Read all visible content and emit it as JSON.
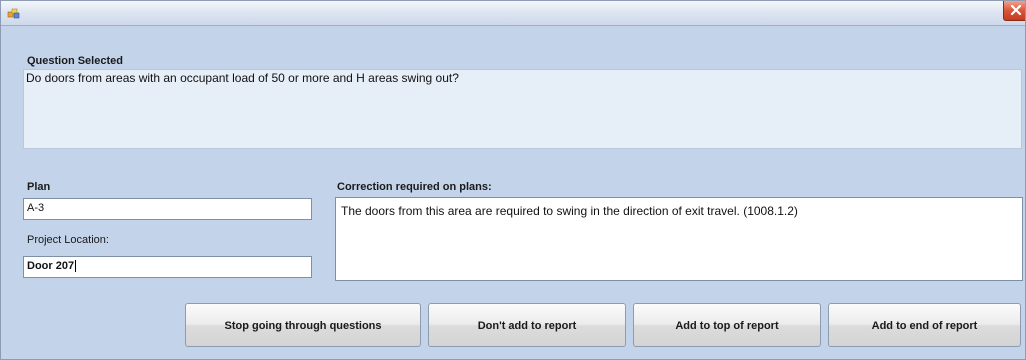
{
  "window": {
    "title": "",
    "accent_color": "#c3d3ea",
    "icons": {
      "app": "app-icon",
      "close": "close-icon"
    }
  },
  "question": {
    "label": "Question Selected",
    "text": "Do doors from areas with an occupant load of 50 or more and H areas swing out?"
  },
  "plan": {
    "label": "Plan",
    "value": "A-3"
  },
  "project_location": {
    "label": "Project Location:",
    "value": "Door 207"
  },
  "correction": {
    "label": "Correction required on plans:",
    "text": "The doors from this area are required to swing in the direction of exit travel. (1008.1.2)"
  },
  "buttons": {
    "stop": "Stop going through questions",
    "dont_add": "Don't add to report",
    "add_top": "Add to top of report",
    "add_end": "Add to end of report"
  }
}
